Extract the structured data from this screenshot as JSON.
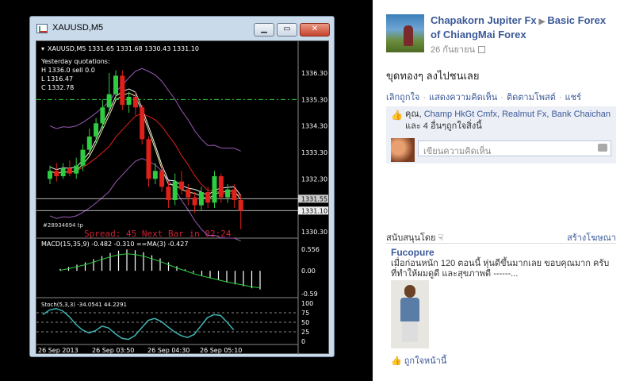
{
  "mt4": {
    "window_title": "XAUUSD,M5",
    "chart_header": "XAUUSD,M5  1331.65 1331.68 1330.43 1331.10",
    "info_lines": [
      "Yesterday quotations:",
      "H 1336.0  sell 0.0",
      "L 1316.47",
      "C 1332.78"
    ],
    "order_label": "#28934694 tp",
    "spread_text": "Spread: 45  Next Bar in 02:24",
    "macd_label": "MACD(15,35,9) -0.482 -0.310  ==MA(3) -0.427",
    "stoch_label": "Stoch(5,3,3) -34.0541 44.2291",
    "price_ticks": [
      "1336.30",
      "1335.30",
      "1334.30",
      "1333.30",
      "1332.30",
      "1331.55",
      "1331.10",
      "1330.30"
    ],
    "macd_ticks": [
      "0.556",
      "0.00",
      "-0.59"
    ],
    "stoch_ticks": [
      "100",
      "75",
      "50",
      "25",
      "0"
    ],
    "time_labels": [
      "26 Sep 2013",
      "26 Sep 03:50",
      "26 Sep 04:30",
      "26 Sep 05:10"
    ],
    "colors": {
      "bull": "#2ecc40",
      "bear": "#e0201a",
      "ma_white": "#f0f0f0",
      "ma_yellow": "#e8e8a0",
      "band": "#9b59b6",
      "macd_line": "#2ecc40",
      "stoch": "#3fb3b3"
    }
  },
  "facebook": {
    "author": "Chapakorn Jupiter Fx",
    "page_name": "Basic Forex of ChiangMai Forex",
    "date": "26 กันยายน",
    "post_text": "ขุดทองๆ ลงไปชนเลย",
    "actions": [
      "เลิกถูกใจ",
      "แสดงความคิดเห็น",
      "ติดตามโพสต์",
      "แชร์"
    ],
    "likes_prefix": "คุณ, ",
    "likes_names": "Champ HkGt Cmfx, Realmut Fx, Bank Chaichan",
    "likes_suffix": " และ 4 อื่นๆถูกใจสิ่งนี้",
    "comment_placeholder": "เขียนความคิดเห็น",
    "sponsored_label": "สนับสนุนโดย",
    "create_ad": "สร้างโฆษณา",
    "ad_title": "Fucopure",
    "ad_body": "เมื่อก่อนหนัก 120 ตอนนี้ หุ่นดีขึ้นมากเลย ขอบคุณมาก ครับ ที่ทำให้ผมดูดี และสุขภาพดี ------...",
    "ad_like": "ถูกใจหน้านี้"
  },
  "chart_data": {
    "type": "candlestick",
    "title": "XAUUSD,M5",
    "candles": [
      {
        "o": 1332.3,
        "c": 1332.6,
        "h": 1332.8,
        "l": 1332.1
      },
      {
        "o": 1332.6,
        "c": 1332.4,
        "h": 1332.9,
        "l": 1332.2
      },
      {
        "o": 1332.4,
        "c": 1332.7,
        "h": 1332.9,
        "l": 1332.3
      },
      {
        "o": 1332.7,
        "c": 1332.5,
        "h": 1333.0,
        "l": 1332.4
      },
      {
        "o": 1332.5,
        "c": 1332.8,
        "h": 1333.1,
        "l": 1332.3
      },
      {
        "o": 1332.8,
        "c": 1333.4,
        "h": 1333.6,
        "l": 1332.6
      },
      {
        "o": 1333.4,
        "c": 1333.9,
        "h": 1334.2,
        "l": 1333.2
      },
      {
        "o": 1333.9,
        "c": 1334.4,
        "h": 1334.6,
        "l": 1333.6
      },
      {
        "o": 1334.4,
        "c": 1335.0,
        "h": 1335.3,
        "l": 1334.2
      },
      {
        "o": 1335.0,
        "c": 1335.5,
        "h": 1336.3,
        "l": 1334.8
      },
      {
        "o": 1335.5,
        "c": 1336.2,
        "h": 1336.4,
        "l": 1335.3
      },
      {
        "o": 1336.2,
        "c": 1335.1,
        "h": 1336.4,
        "l": 1334.9
      },
      {
        "o": 1335.1,
        "c": 1335.4,
        "h": 1335.6,
        "l": 1334.8
      },
      {
        "o": 1335.4,
        "c": 1335.0,
        "h": 1335.6,
        "l": 1334.7
      },
      {
        "o": 1335.0,
        "c": 1333.8,
        "h": 1335.1,
        "l": 1333.6
      },
      {
        "o": 1333.8,
        "c": 1332.3,
        "h": 1333.9,
        "l": 1332.0
      },
      {
        "o": 1332.3,
        "c": 1332.6,
        "h": 1332.9,
        "l": 1332.1
      },
      {
        "o": 1332.6,
        "c": 1332.0,
        "h": 1332.8,
        "l": 1331.8
      },
      {
        "o": 1332.0,
        "c": 1331.5,
        "h": 1332.2,
        "l": 1331.2
      },
      {
        "o": 1331.5,
        "c": 1332.2,
        "h": 1332.5,
        "l": 1331.3
      },
      {
        "o": 1332.2,
        "c": 1331.9,
        "h": 1332.6,
        "l": 1331.7
      },
      {
        "o": 1331.9,
        "c": 1331.6,
        "h": 1332.1,
        "l": 1331.3
      },
      {
        "o": 1331.6,
        "c": 1331.3,
        "h": 1331.8,
        "l": 1331.0
      },
      {
        "o": 1331.3,
        "c": 1331.8,
        "h": 1332.0,
        "l": 1331.1
      },
      {
        "o": 1331.8,
        "c": 1331.4,
        "h": 1332.0,
        "l": 1331.2
      },
      {
        "o": 1331.4,
        "c": 1332.4,
        "h": 1332.6,
        "l": 1331.2
      },
      {
        "o": 1332.4,
        "c": 1331.6,
        "h": 1332.5,
        "l": 1331.4
      },
      {
        "o": 1331.6,
        "c": 1331.9,
        "h": 1332.1,
        "l": 1331.4
      },
      {
        "o": 1331.9,
        "c": 1331.5,
        "h": 1332.1,
        "l": 1331.2
      },
      {
        "o": 1331.5,
        "c": 1331.1,
        "h": 1331.7,
        "l": 1330.4
      }
    ],
    "ylim": [
      1330.3,
      1336.3
    ],
    "stoch": [
      70,
      82,
      86,
      80,
      65,
      45,
      30,
      22,
      28,
      40,
      35,
      20,
      8,
      5,
      15,
      35,
      55,
      60,
      52,
      38,
      25,
      15,
      10,
      18,
      40,
      62,
      70,
      68,
      50,
      30
    ],
    "macd_hist": [
      0.05,
      0.1,
      0.16,
      0.22,
      0.3,
      0.38,
      0.46,
      0.52,
      0.55,
      0.53,
      0.48,
      0.4,
      0.32,
      0.22,
      0.12,
      0.04,
      -0.05,
      -0.12,
      -0.18,
      -0.24,
      -0.3,
      -0.35,
      -0.4,
      -0.45,
      -0.48
    ]
  }
}
